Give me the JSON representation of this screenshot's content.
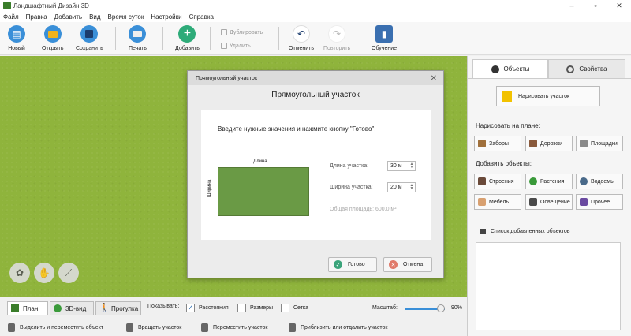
{
  "window": {
    "title": "Ландшафтный Дизайн 3D"
  },
  "menu": [
    "Файл",
    "Правка",
    "Добавить",
    "Вид",
    "Время суток",
    "Настройки",
    "Справка"
  ],
  "toolbar": {
    "new": "Новый",
    "open": "Открыть",
    "save": "Сохранить",
    "print": "Печать",
    "add": "Добавить",
    "duplicate": "Дублировать",
    "delete": "Удалить",
    "undo": "Отменить",
    "redo": "Повторить",
    "tutorial": "Обучение"
  },
  "dialog": {
    "header": "Прямоугольный участок",
    "title": "Прямоугольный участок",
    "instruction": "Введите нужные значения и нажмите кнопку \"Готово\":",
    "length_caption": "Длина",
    "width_caption": "Ширина",
    "length_label": "Длина участка:",
    "length_value": "30 м",
    "width_label": "Ширина участка:",
    "width_value": "20 м",
    "area_text": "Общая площадь: 600,0 м²",
    "ok": "Готово",
    "cancel": "Отмена"
  },
  "panel": {
    "tab_objects": "Объекты",
    "tab_properties": "Свойства",
    "draw_plot": "Нарисовать участок",
    "draw_on_plan": "Нарисовать на плане:",
    "fences": "Заборы",
    "paths": "Дорожки",
    "areas": "Площадки",
    "add_objects": "Добавить объекты:",
    "buildings": "Строения",
    "plants": "Растения",
    "ponds": "Водоемы",
    "furniture": "Мебель",
    "lighting": "Освещение",
    "other": "Прочее",
    "list_title": "Список добавленных объектов"
  },
  "bottom": {
    "plan": "План",
    "view3d": "3D-вид",
    "walk": "Прогулка",
    "show": "Показывать:",
    "distances": "Расстояния",
    "sizes": "Размеры",
    "grid": "Сетка",
    "scale_label": "Масштаб:",
    "scale_value": "90%",
    "scale_fraction": 0.9
  },
  "status": {
    "select": "Выделить и переместить объект",
    "rotate": "Вращать участок",
    "move": "Переместить участок",
    "zoom": "Приблизить или отдалить участок"
  },
  "checks": {
    "distances": true,
    "sizes": false,
    "grid": false
  },
  "colors": {
    "grass": "#8fb43c",
    "plot": "#6a9a45",
    "accent": "#3a8fd8",
    "ok": "#3aa37a",
    "cancel": "#e07a6a",
    "add": "#2eab79"
  }
}
